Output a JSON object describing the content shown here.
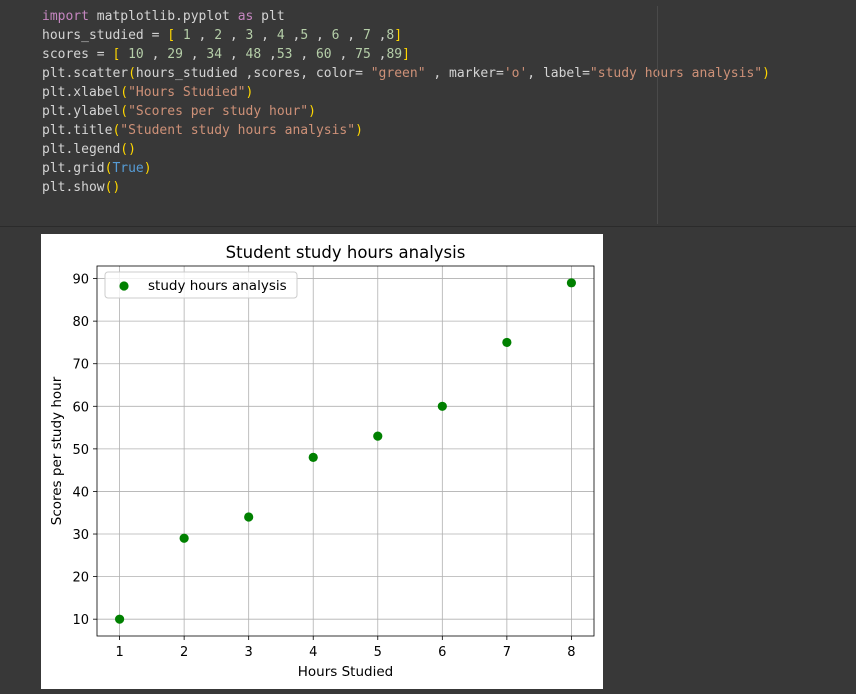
{
  "code_lines": [
    [
      [
        "kw",
        "import"
      ],
      [
        "t",
        " matplotlib.pyplot "
      ],
      [
        "kw",
        "as"
      ],
      [
        "t",
        " plt"
      ]
    ],
    [
      [
        "t",
        "hours_studied = "
      ],
      [
        "br",
        "["
      ],
      [
        "t",
        " "
      ],
      [
        "num",
        "1"
      ],
      [
        "t",
        " , "
      ],
      [
        "num",
        "2"
      ],
      [
        "t",
        " , "
      ],
      [
        "num",
        "3"
      ],
      [
        "t",
        " , "
      ],
      [
        "num",
        "4"
      ],
      [
        "t",
        " ,"
      ],
      [
        "num",
        "5"
      ],
      [
        "t",
        " , "
      ],
      [
        "num",
        "6"
      ],
      [
        "t",
        " , "
      ],
      [
        "num",
        "7"
      ],
      [
        "t",
        " ,"
      ],
      [
        "num",
        "8"
      ],
      [
        "br",
        "]"
      ]
    ],
    [
      [
        "t",
        "scores = "
      ],
      [
        "br",
        "["
      ],
      [
        "t",
        " "
      ],
      [
        "num",
        "10"
      ],
      [
        "t",
        " , "
      ],
      [
        "num",
        "29"
      ],
      [
        "t",
        " , "
      ],
      [
        "num",
        "34"
      ],
      [
        "t",
        " , "
      ],
      [
        "num",
        "48"
      ],
      [
        "t",
        " ,"
      ],
      [
        "num",
        "53"
      ],
      [
        "t",
        " , "
      ],
      [
        "num",
        "60"
      ],
      [
        "t",
        " , "
      ],
      [
        "num",
        "75"
      ],
      [
        "t",
        " ,"
      ],
      [
        "num",
        "89"
      ],
      [
        "br",
        "]"
      ]
    ],
    [
      [
        "t",
        "plt.scatter"
      ],
      [
        "br",
        "("
      ],
      [
        "t",
        "hours_studied ,scores, color= "
      ],
      [
        "str",
        "\"green\""
      ],
      [
        "t",
        " , marker="
      ],
      [
        "str",
        "'o'"
      ],
      [
        "t",
        ", label="
      ],
      [
        "str",
        "\"study hours analysis\""
      ],
      [
        "br",
        ")"
      ]
    ],
    [
      [
        "t",
        "plt.xlabel"
      ],
      [
        "br",
        "("
      ],
      [
        "str",
        "\"Hours Studied\""
      ],
      [
        "br",
        ")"
      ]
    ],
    [
      [
        "t",
        "plt.ylabel"
      ],
      [
        "br",
        "("
      ],
      [
        "str",
        "\"Scores per study hour\""
      ],
      [
        "br",
        ")"
      ]
    ],
    [
      [
        "t",
        "plt.title"
      ],
      [
        "br",
        "("
      ],
      [
        "str",
        "\"Student study hours analysis\""
      ],
      [
        "br",
        ")"
      ]
    ],
    [
      [
        "t",
        "plt.legend"
      ],
      [
        "br",
        "()"
      ]
    ],
    [
      [
        "t",
        "plt.grid"
      ],
      [
        "br",
        "("
      ],
      [
        "const",
        "True"
      ],
      [
        "br",
        ")"
      ]
    ],
    [
      [
        "t",
        "plt.show"
      ],
      [
        "br",
        "()"
      ]
    ]
  ],
  "chart_data": {
    "type": "scatter",
    "title": "Student study hours analysis",
    "xlabel": "Hours Studied",
    "ylabel": "Scores per study hour",
    "x": [
      1,
      2,
      3,
      4,
      5,
      6,
      7,
      8
    ],
    "y": [
      10,
      29,
      34,
      48,
      53,
      60,
      75,
      89
    ],
    "series": [
      {
        "name": "study hours analysis",
        "color": "#008000",
        "marker": "o"
      }
    ],
    "xticks": [
      "1",
      "2",
      "3",
      "4",
      "5",
      "6",
      "7",
      "8"
    ],
    "yticks": [
      "10",
      "20",
      "30",
      "40",
      "50",
      "60",
      "70",
      "80",
      "90"
    ],
    "xlim": [
      0.65,
      8.35
    ],
    "ylim": [
      6.05,
      92.95
    ],
    "grid": true,
    "legend_loc": "upper left"
  }
}
